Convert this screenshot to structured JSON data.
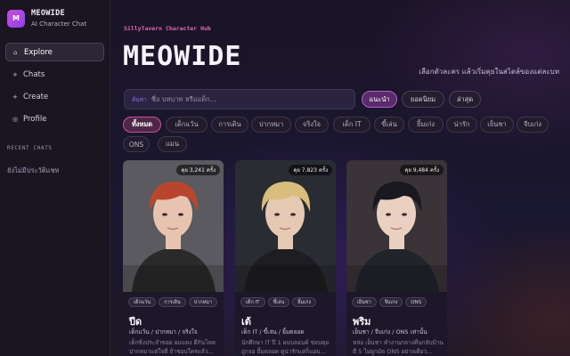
{
  "brand": {
    "logo": "M",
    "name": "MEOWIDE",
    "subtitle": "AI Character Chat"
  },
  "nav": [
    {
      "icon": "⌂",
      "icon_name": "home-icon",
      "label": "Explore",
      "active": true
    },
    {
      "icon": "+",
      "icon_name": "chat-icon",
      "label": "Chats"
    },
    {
      "icon": "+",
      "icon_name": "plus-icon",
      "label": "Create"
    },
    {
      "icon": "◎",
      "icon_name": "profile-icon",
      "label": "Profile"
    }
  ],
  "recent": {
    "heading": "RECENT CHATS",
    "empty": "ยังไม่มีประวัติแชท"
  },
  "hero": {
    "eyebrow": "SillyTavern Character Hub",
    "title": "MEOWIDE",
    "subtitle": "เลือกตัวละคร แล้วเริ่มคุยในสไตล์ของแต่ละบท"
  },
  "search": {
    "label": "ค้นหา",
    "placeholder": "ชื่อ บทบาท หรือแท็ก..."
  },
  "sort": [
    {
      "label": "แนะนำ",
      "active": true
    },
    {
      "label": "ยอดนิยม"
    },
    {
      "label": "ล่าสุด"
    }
  ],
  "filters": [
    "ทั้งหมด",
    "เด็กแว้น",
    "การเดิน",
    "ปากหมา",
    "จริงใจ",
    "เด็ก IT",
    "ขี้เล่น",
    "ยิ้มเก่ง",
    "น่ารัก",
    "เย็นชา",
    "จีบเก่ง",
    "ONS",
    "แมน"
  ],
  "active_filter": 0,
  "cards": [
    {
      "count": "คุย 3,241 ครั้ง",
      "tags": [
        "เด็กแว้น",
        "การเดิน",
        "ปากหมา"
      ],
      "name": "ปีด",
      "tagline": "เด็กแว้น / ปากหมา / จริงใจ",
      "desc": "เด็กซิ่งประจำซอย ผมแดง ดีกันโหด ปากหมาแต่ใจดี ถ้าชอบใครแล้ว...",
      "palette": {
        "bg": "#5a5a60",
        "hair": "#b8462e",
        "shirt": "#2a2a2a",
        "skin": "#e8c4b0"
      }
    },
    {
      "count": "คุย 7,823 ครั้ง",
      "tags": [
        "เด็ก IT",
        "ขี้เล่น",
        "ยิ้มเก่ง"
      ],
      "name": "เต้",
      "tagline": "เด็ก IT / ขี้เล่น / ยิ้มตลอด",
      "desc": "นักศึกษา IT ปี 1 ผมบลอนด์ ชอบคุยถูกจอ ยิ้มตลอด ดูน่ารักแต่ก็แอบ...",
      "palette": {
        "bg": "#2a2c33",
        "hair": "#d8bd7c",
        "shirt": "#1e1e22",
        "skin": "#e6c9b2"
      }
    },
    {
      "count": "คุย 9,484 ครั้ง",
      "tags": [
        "เย็นชา",
        "จีบเก่ง",
        "ONS"
      ],
      "name": "พริม",
      "tagline": "เย็นชา / จีบเก่ง / ONS เท่านั้น",
      "desc": "หล่อ เย็นชา ทำงานกลางคืนกลับบ้านตี 5 ไม่ผูกมัด ONS อย่างเดียว...",
      "palette": {
        "bg": "#3a3338",
        "hair": "#1a1820",
        "shirt": "#22242c",
        "skin": "#ead0c0"
      }
    }
  ]
}
